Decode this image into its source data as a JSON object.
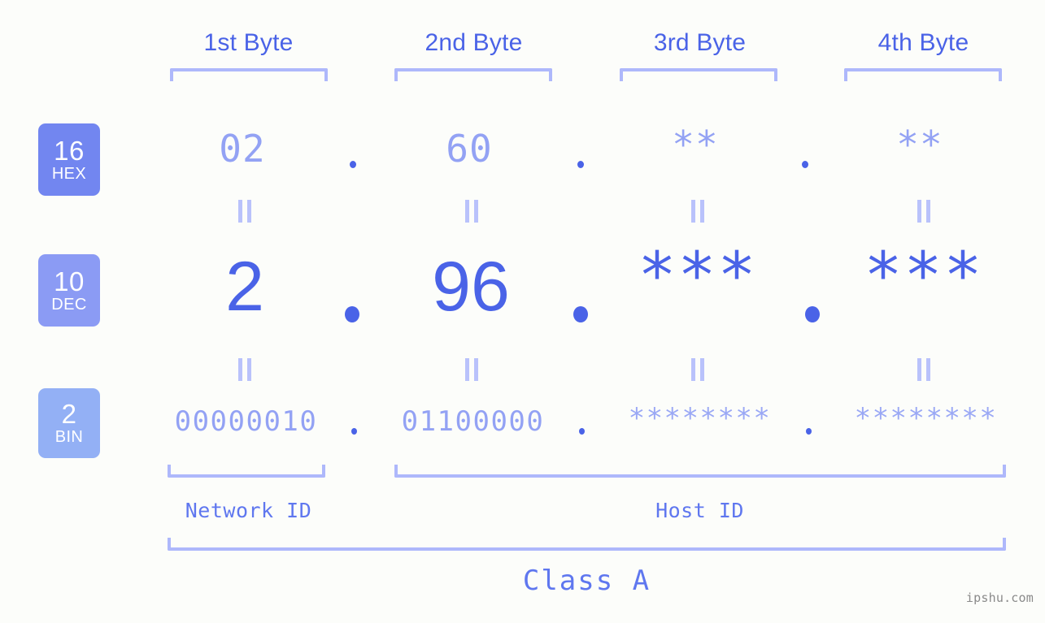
{
  "background_color": "#fcfdfa",
  "accent_color": "#4a63e7",
  "muted_accent_color": "#93a2f4",
  "bracket_color": "#aeb8fb",
  "headers": {
    "byte1": "1st Byte",
    "byte2": "2nd Byte",
    "byte3": "3rd Byte",
    "byte4": "4th Byte"
  },
  "bases": [
    {
      "number": "16",
      "name": "HEX",
      "color": "#7286f0"
    },
    {
      "number": "10",
      "name": "DEC",
      "color": "#8b9bf4"
    },
    {
      "number": "2",
      "name": "BIN",
      "color": "#93b0f5"
    }
  ],
  "rows": {
    "hex": {
      "base_number": "16",
      "base_name": "HEX",
      "values": [
        "02",
        "60",
        "**",
        "**"
      ],
      "separator": "."
    },
    "dec": {
      "base_number": "10",
      "base_name": "DEC",
      "values": [
        "2",
        "96",
        "***",
        "***"
      ],
      "separator": "."
    },
    "bin": {
      "base_number": "2",
      "base_name": "BIN",
      "values": [
        "00000010",
        "01100000",
        "********",
        "********"
      ],
      "separator": "."
    }
  },
  "equality_mark": "||",
  "sections": {
    "network_id": "Network ID",
    "host_id": "Host ID"
  },
  "class_label": "Class A",
  "watermark": "ipshu.com"
}
